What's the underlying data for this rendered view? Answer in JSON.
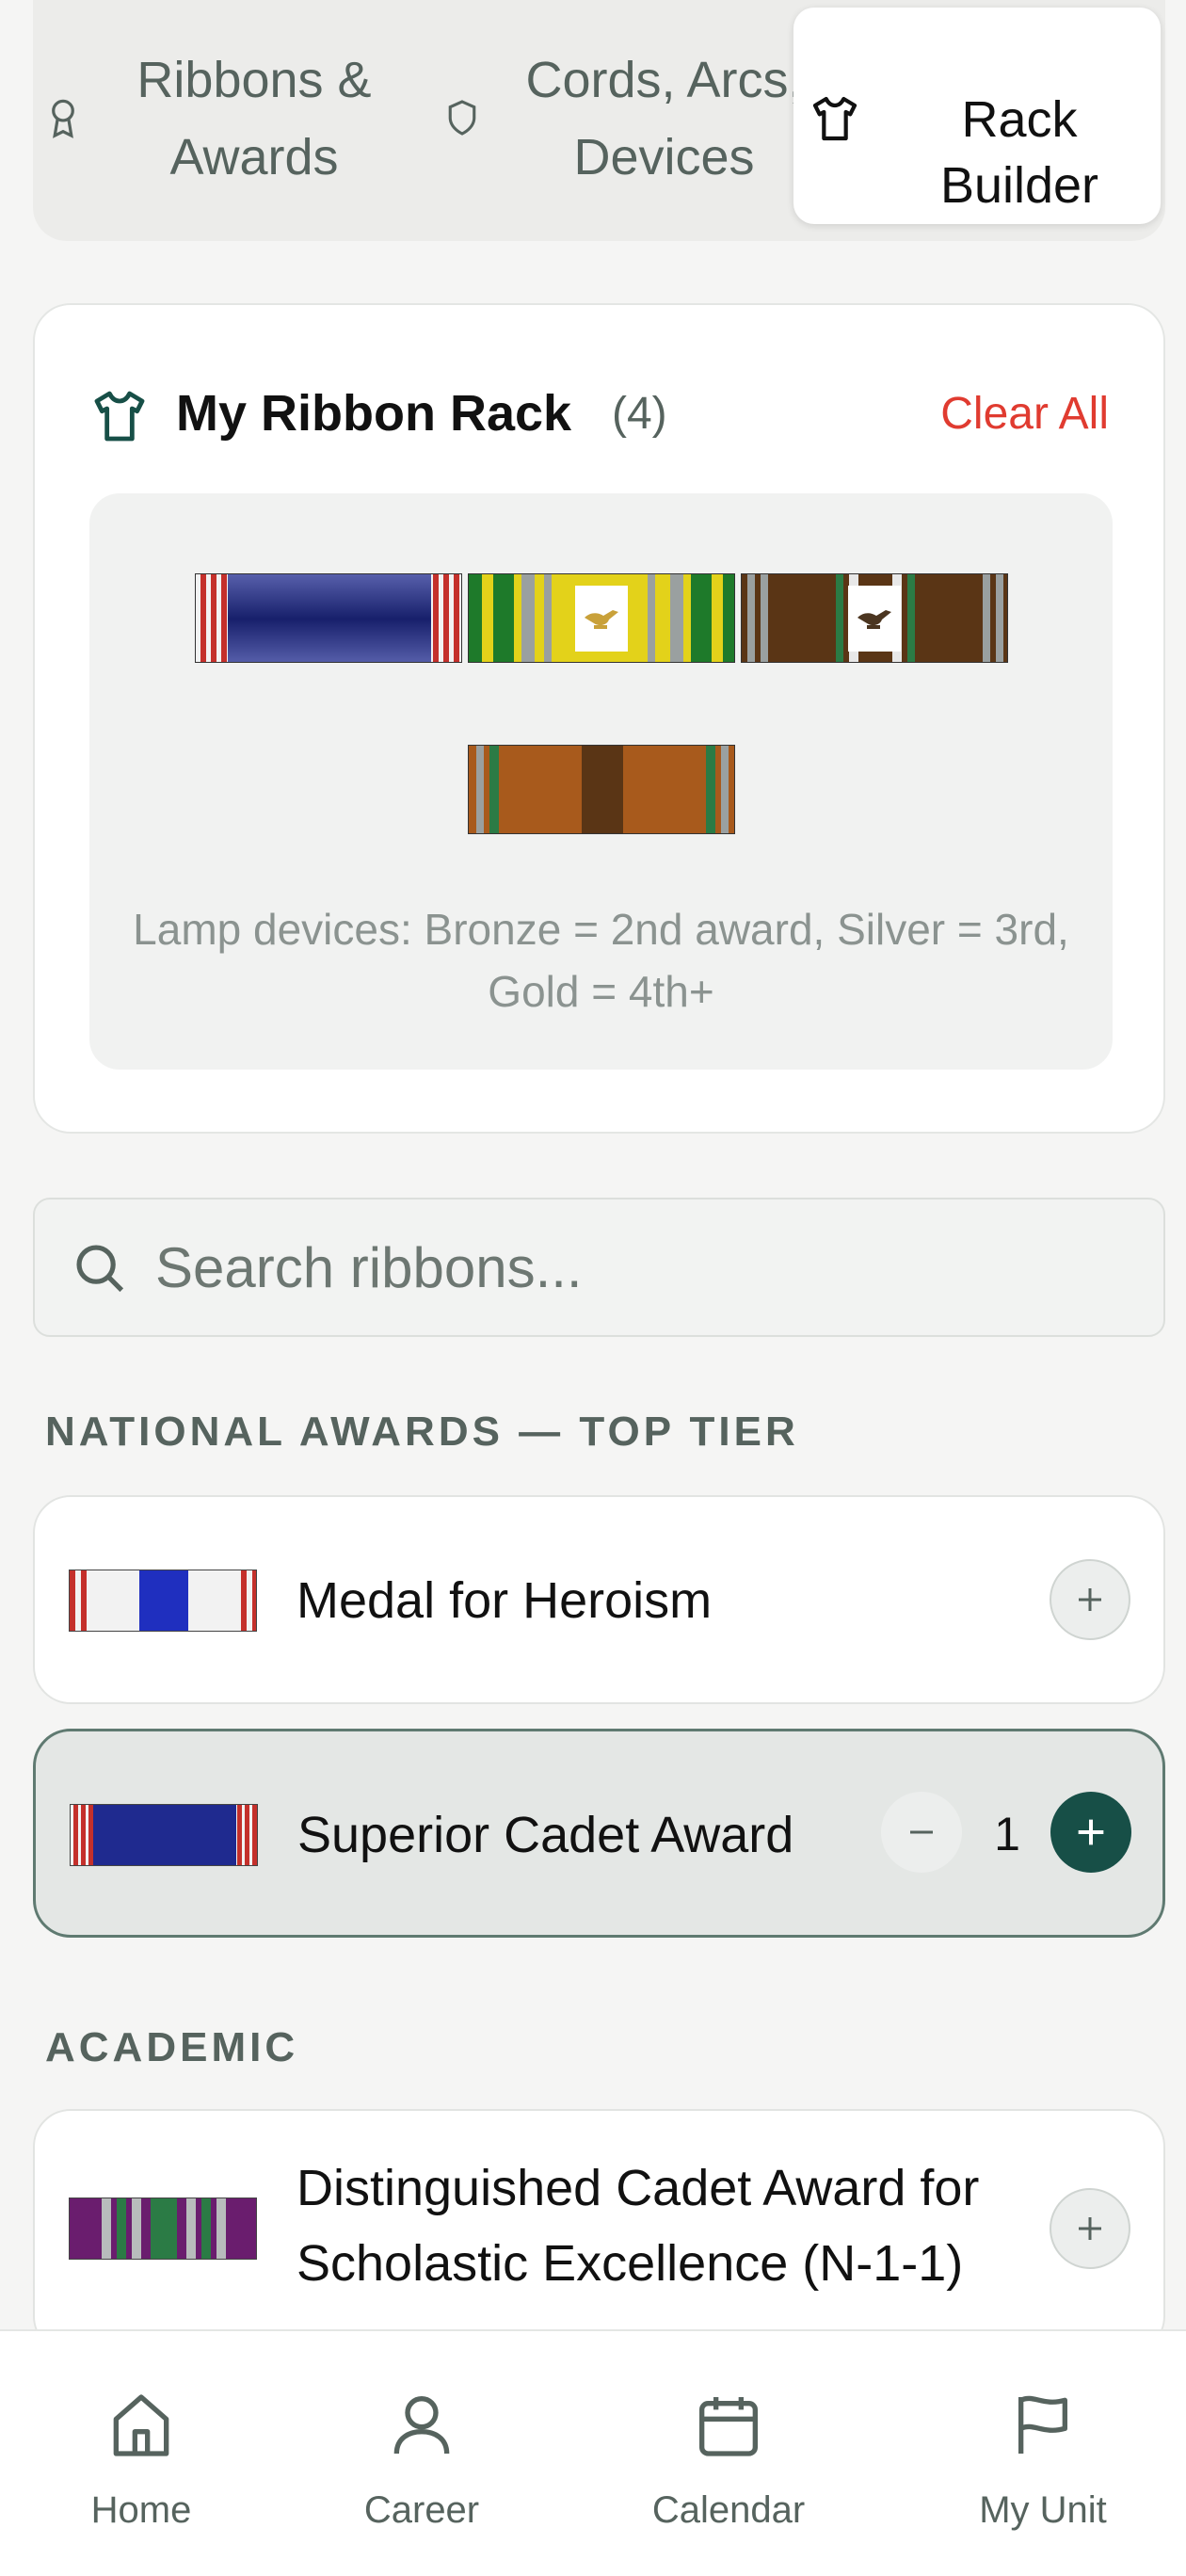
{
  "tabs": [
    {
      "label": "Ribbons & Awards",
      "icon": "award-icon",
      "active": false
    },
    {
      "label": "Cords, Arcs, Devices",
      "icon": "shield-icon",
      "active": false
    },
    {
      "label": "Rack Builder",
      "icon": "shirt-icon",
      "active": true
    }
  ],
  "rack": {
    "title": "My Ribbon Rack",
    "count": "(4)",
    "clear_label": "Clear All",
    "note": "Lamp devices: Bronze = 2nd award, Silver = 3rd, Gold = 4th+",
    "ribbons": [
      {
        "name": "Superior Cadet Award",
        "device": null
      },
      {
        "name": "Yellow/green service ribbon",
        "device": "gold-lamp"
      },
      {
        "name": "Brown service ribbon",
        "device": "bronze-lamp"
      },
      {
        "name": "Orange-brown service ribbon",
        "device": null
      }
    ]
  },
  "search": {
    "placeholder": "Search ribbons..."
  },
  "sections": [
    {
      "label": "NATIONAL AWARDS — TOP TIER",
      "items": [
        {
          "name": "Medal for Heroism",
          "selected": false
        },
        {
          "name": "Superior Cadet Award",
          "selected": true,
          "quantity": "1"
        }
      ]
    },
    {
      "label": "ACADEMIC",
      "items": [
        {
          "name": "Distinguished Cadet Award for Scholastic Excellence (N-1-1)",
          "selected": false
        }
      ]
    }
  ],
  "nav": [
    {
      "label": "Home",
      "icon": "home-icon"
    },
    {
      "label": "Career",
      "icon": "person-icon"
    },
    {
      "label": "Calendar",
      "icon": "calendar-icon"
    },
    {
      "label": "My Unit",
      "icon": "flag-icon"
    }
  ],
  "colors": {
    "accent_dark": "#174f47",
    "clear_red": "#e03b30",
    "muted_text": "#56635e",
    "selected_bg": "#e4e7e5"
  }
}
